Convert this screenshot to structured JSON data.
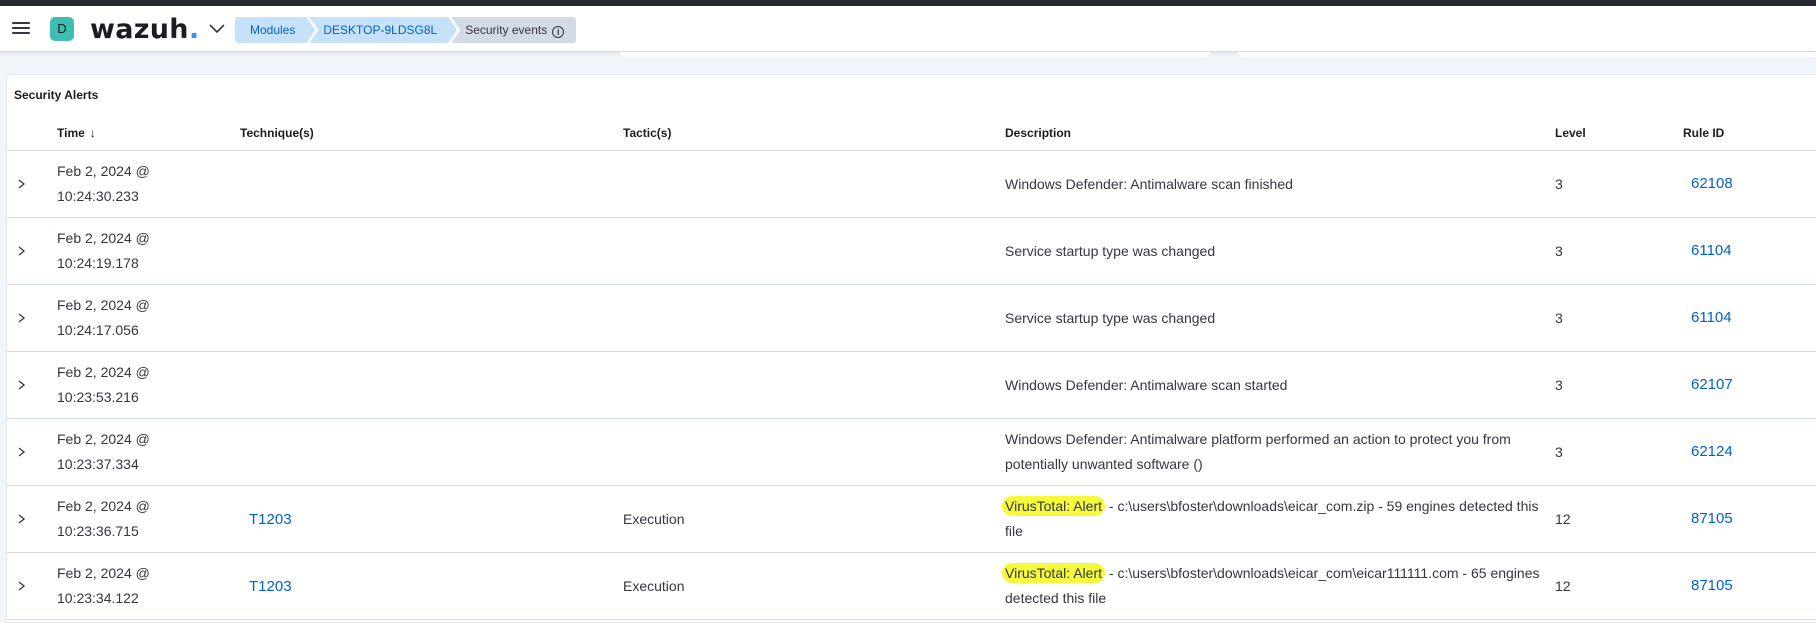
{
  "header": {
    "avatar_letter": "D",
    "logo_text": "wazuh",
    "logo_dot": ".",
    "breadcrumbs": [
      "Modules",
      "DESKTOP-9LDSG8L",
      "Security events"
    ],
    "colors": {
      "accent": "#3ebeb0",
      "link": "#0061c2",
      "highlight": "#f6f93c"
    }
  },
  "panel": {
    "title": "Security Alerts",
    "columns": {
      "time": "Time",
      "technique": "Technique(s)",
      "tactic": "Tactic(s)",
      "description": "Description",
      "level": "Level",
      "rule_id": "Rule ID"
    },
    "rows": [
      {
        "date": "Feb 2, 2024 @",
        "clock": "10:24:30.233",
        "technique": "",
        "tactic": "",
        "desc_highlight": "",
        "description": "Windows Defender: Antimalware scan finished",
        "level": "3",
        "rule_id": "62108"
      },
      {
        "date": "Feb 2, 2024 @",
        "clock": "10:24:19.178",
        "technique": "",
        "tactic": "",
        "desc_highlight": "",
        "description": "Service startup type was changed",
        "level": "3",
        "rule_id": "61104"
      },
      {
        "date": "Feb 2, 2024 @",
        "clock": "10:24:17.056",
        "technique": "",
        "tactic": "",
        "desc_highlight": "",
        "description": "Service startup type was changed",
        "level": "3",
        "rule_id": "61104"
      },
      {
        "date": "Feb 2, 2024 @",
        "clock": "10:23:53.216",
        "technique": "",
        "tactic": "",
        "desc_highlight": "",
        "description": "Windows Defender: Antimalware scan started",
        "level": "3",
        "rule_id": "62107"
      },
      {
        "date": "Feb 2, 2024 @",
        "clock": "10:23:37.334",
        "technique": "",
        "tactic": "",
        "desc_highlight": "",
        "description": "Windows Defender: Antimalware platform performed an action to protect you from potentially unwanted software ()",
        "level": "3",
        "rule_id": "62124"
      },
      {
        "date": "Feb 2, 2024 @",
        "clock": "10:23:36.715",
        "technique": "T1203",
        "tactic": "Execution",
        "desc_highlight": "VirusTotal: Alert",
        "description": " - c:\\users\\bfoster\\downloads\\eicar_com.zip - 59 engines detected this file",
        "level": "12",
        "rule_id": "87105"
      },
      {
        "date": "Feb 2, 2024 @",
        "clock": "10:23:34.122",
        "technique": "T1203",
        "tactic": "Execution",
        "desc_highlight": "VirusTotal: Alert",
        "description": " - c:\\users\\bfoster\\downloads\\eicar_com\\eicar111111.com - 65 engines detected this file",
        "level": "12",
        "rule_id": "87105"
      }
    ]
  }
}
